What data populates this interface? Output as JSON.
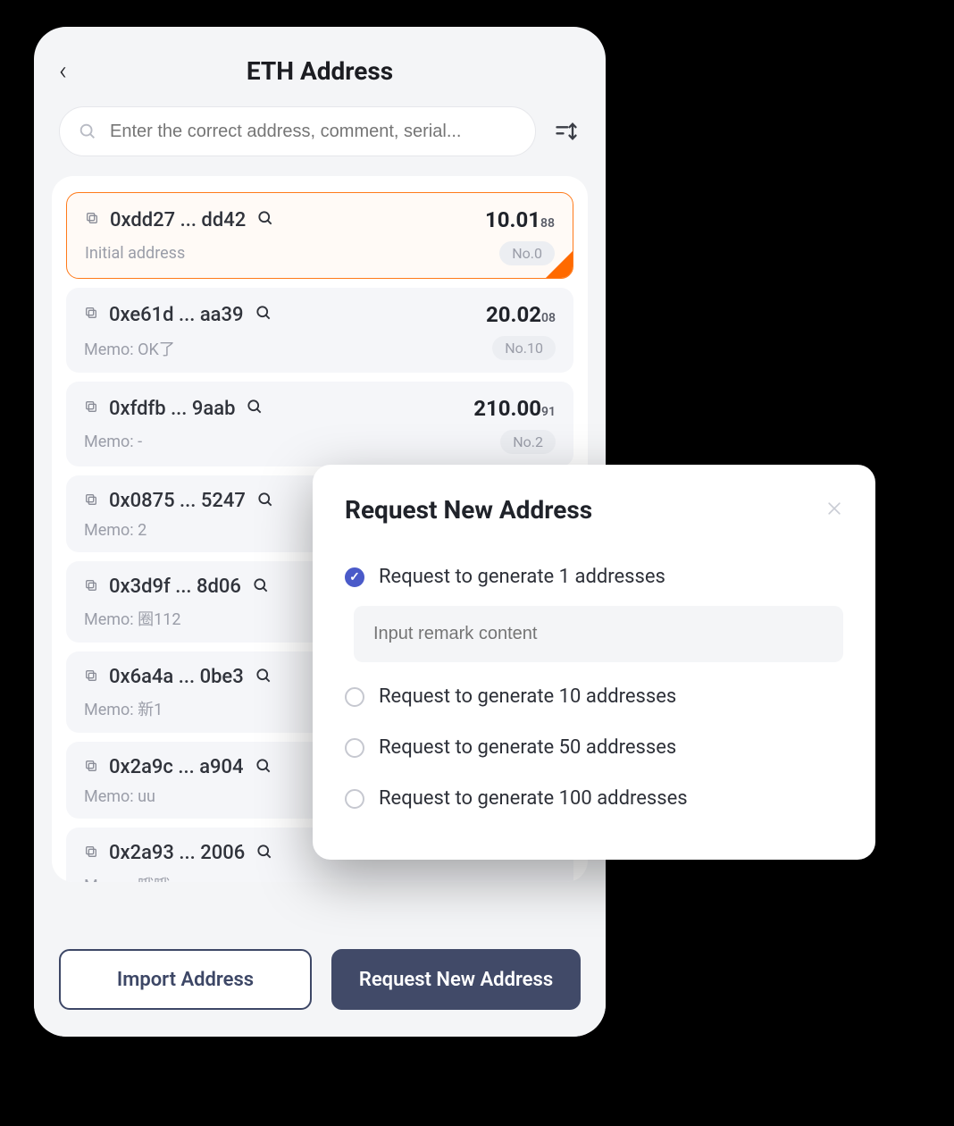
{
  "header": {
    "title": "ETH Address",
    "back_icon": "‹"
  },
  "search": {
    "placeholder": "Enter the correct address, comment, serial..."
  },
  "addresses": [
    {
      "addr": "0xdd27 ... dd42",
      "balance": "10.01",
      "balance_sub": "88",
      "memo": "Initial address",
      "badge": "No.0",
      "selected": true
    },
    {
      "addr": "0xe61d ... aa39",
      "balance": "20.02",
      "balance_sub": "08",
      "memo": "Memo: OK了",
      "badge": "No.10",
      "selected": false
    },
    {
      "addr": "0xfdfb ... 9aab",
      "balance": "210.00",
      "balance_sub": "91",
      "memo": "Memo: -",
      "badge": "No.2",
      "selected": false
    },
    {
      "addr": "0x0875 ... 5247",
      "balance": "",
      "balance_sub": "",
      "memo": "Memo: 2",
      "badge": "",
      "selected": false
    },
    {
      "addr": "0x3d9f ... 8d06",
      "balance": "",
      "balance_sub": "",
      "memo": "Memo: 圈112",
      "badge": "",
      "selected": false
    },
    {
      "addr": "0x6a4a ... 0be3",
      "balance": "",
      "balance_sub": "",
      "memo": "Memo: 新1",
      "badge": "",
      "selected": false
    },
    {
      "addr": "0x2a9c ... a904",
      "balance": "",
      "balance_sub": "",
      "memo": "Memo: uu",
      "badge": "",
      "selected": false
    },
    {
      "addr": "0x2a93 ... 2006",
      "balance": "",
      "balance_sub": "",
      "memo": "Memo: 哦哦",
      "badge": "",
      "selected": false
    }
  ],
  "footer": {
    "import_label": "Import Address",
    "request_label": "Request New Address"
  },
  "modal": {
    "title": "Request New Address",
    "options": [
      {
        "label": "Request to generate 1 addresses",
        "checked": true,
        "has_input": true
      },
      {
        "label": "Request to generate 10 addresses",
        "checked": false,
        "has_input": false
      },
      {
        "label": "Request to generate 50 addresses",
        "checked": false,
        "has_input": false
      },
      {
        "label": "Request to generate 100 addresses",
        "checked": false,
        "has_input": false
      }
    ],
    "remark_placeholder": "Input remark content"
  }
}
